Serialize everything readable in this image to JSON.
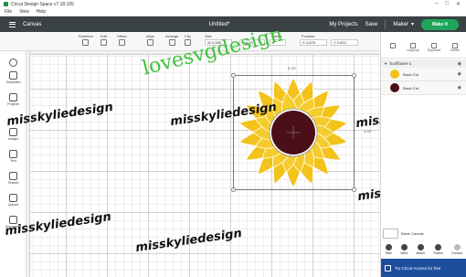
{
  "window": {
    "title": "Cricut Design Space  v7.18.105",
    "controls": [
      "–",
      "□",
      "✕"
    ]
  },
  "menu": [
    "File",
    "View",
    "Help"
  ],
  "header": {
    "canvas_title": "Canvas",
    "doc_title": "Untitled*",
    "my_projects": "My Projects",
    "save": "Save",
    "machine": "Maker",
    "make_it": "Make It"
  },
  "toolbar": {
    "deselect": "Deselect",
    "edit": "Edit",
    "offset": "Offset",
    "align": "Align",
    "arrange": "Arrange",
    "flip": "Flip",
    "size": "Size",
    "rotate": "Rotate",
    "position": "Position",
    "w_value": "4.906",
    "h_value": "4.93",
    "rotate_value": "0",
    "x_value": "4.625",
    "y_value": "0.833"
  },
  "left_sidebar": [
    "Templates",
    "Projects",
    "Images",
    "Text",
    "Shapes",
    "Upload",
    "Monogram"
  ],
  "canvas": {
    "dim_width": "5.33\"",
    "dim_height": "4.93\""
  },
  "watermarks": {
    "green": "lovesvgdesign",
    "black": "misskylliedesign.com",
    "black_short": "misskyliedesign"
  },
  "right_panel": {
    "tools": [
      "Ungroup",
      "Duplicate",
      "Delete"
    ],
    "group_name": "Sunflower-1",
    "layers": [
      {
        "label": "Basic Cut",
        "color": "#f3c21b"
      },
      {
        "label": "Basic Cut",
        "color": "#4b0f18"
      }
    ],
    "blank_canvas": "Blank Canvas",
    "bottom_tools": [
      "Slice",
      "Weld",
      "Attach",
      "Flatten",
      "Contour"
    ],
    "banner": "Try Cricut Access for free"
  },
  "colors": {
    "header": "#3a4244",
    "make_it": "#1fa65c",
    "petal": "#f3c21b",
    "center": "#4b0f18",
    "banner": "#1d4e9e"
  }
}
